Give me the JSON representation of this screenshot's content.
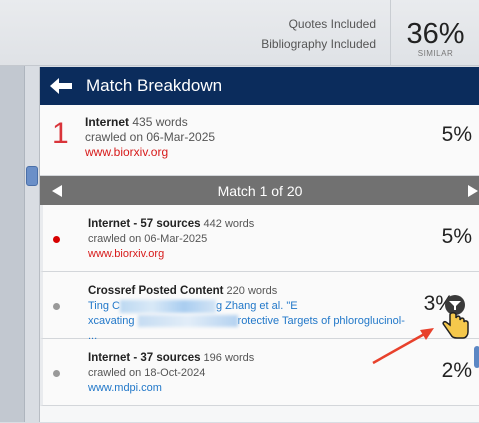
{
  "filters": {
    "quotes": "Quotes Included",
    "bibliography": "Bibliography Included"
  },
  "score": {
    "value": "36%",
    "label": "SIMILAR"
  },
  "panel": {
    "title": "Match Breakdown",
    "top_match": {
      "rank": "1",
      "source_type": "Internet",
      "words": "435 words",
      "crawled": "crawled on 06-Mar-2025",
      "url": "www.biorxiv.org",
      "percent": "5%"
    },
    "navigator": {
      "label": "Match 1 of 20"
    },
    "sources": [
      {
        "title": "Internet - 57 sources",
        "words": "442 words",
        "line1": "crawled on 06-Mar-2025",
        "url": "www.biorxiv.org",
        "percent": "5%",
        "dot_color": "#d70000"
      },
      {
        "title": "Crossref Posted Content",
        "words": "220 words",
        "line1_start": "Ting C",
        "line1_end": "g Zhang et al. \"E",
        "line2_start": "xcavating ",
        "line2_end": "rotective Targets of phloroglucinol-  ...",
        "percent": "3%",
        "dot_color": "#999999"
      },
      {
        "title": "Internet - 37 sources",
        "words": "196 words",
        "line1": "crawled on 18-Oct-2024",
        "url": "www.mdpi.com",
        "percent": "2%",
        "dot_color": "#999999"
      }
    ]
  },
  "colors": {
    "header_bg": "#0b2c5c",
    "rank_red": "#d9343a",
    "link_red": "#d71a1a",
    "link_blue": "#2278c9",
    "annotation_arrow": "#e8412c"
  },
  "icons": {
    "back": "arrow-left-icon",
    "prev": "triangle-left-icon",
    "next": "triangle-right-icon",
    "filter": "filter-icon",
    "cursor": "hand-pointer-icon"
  }
}
